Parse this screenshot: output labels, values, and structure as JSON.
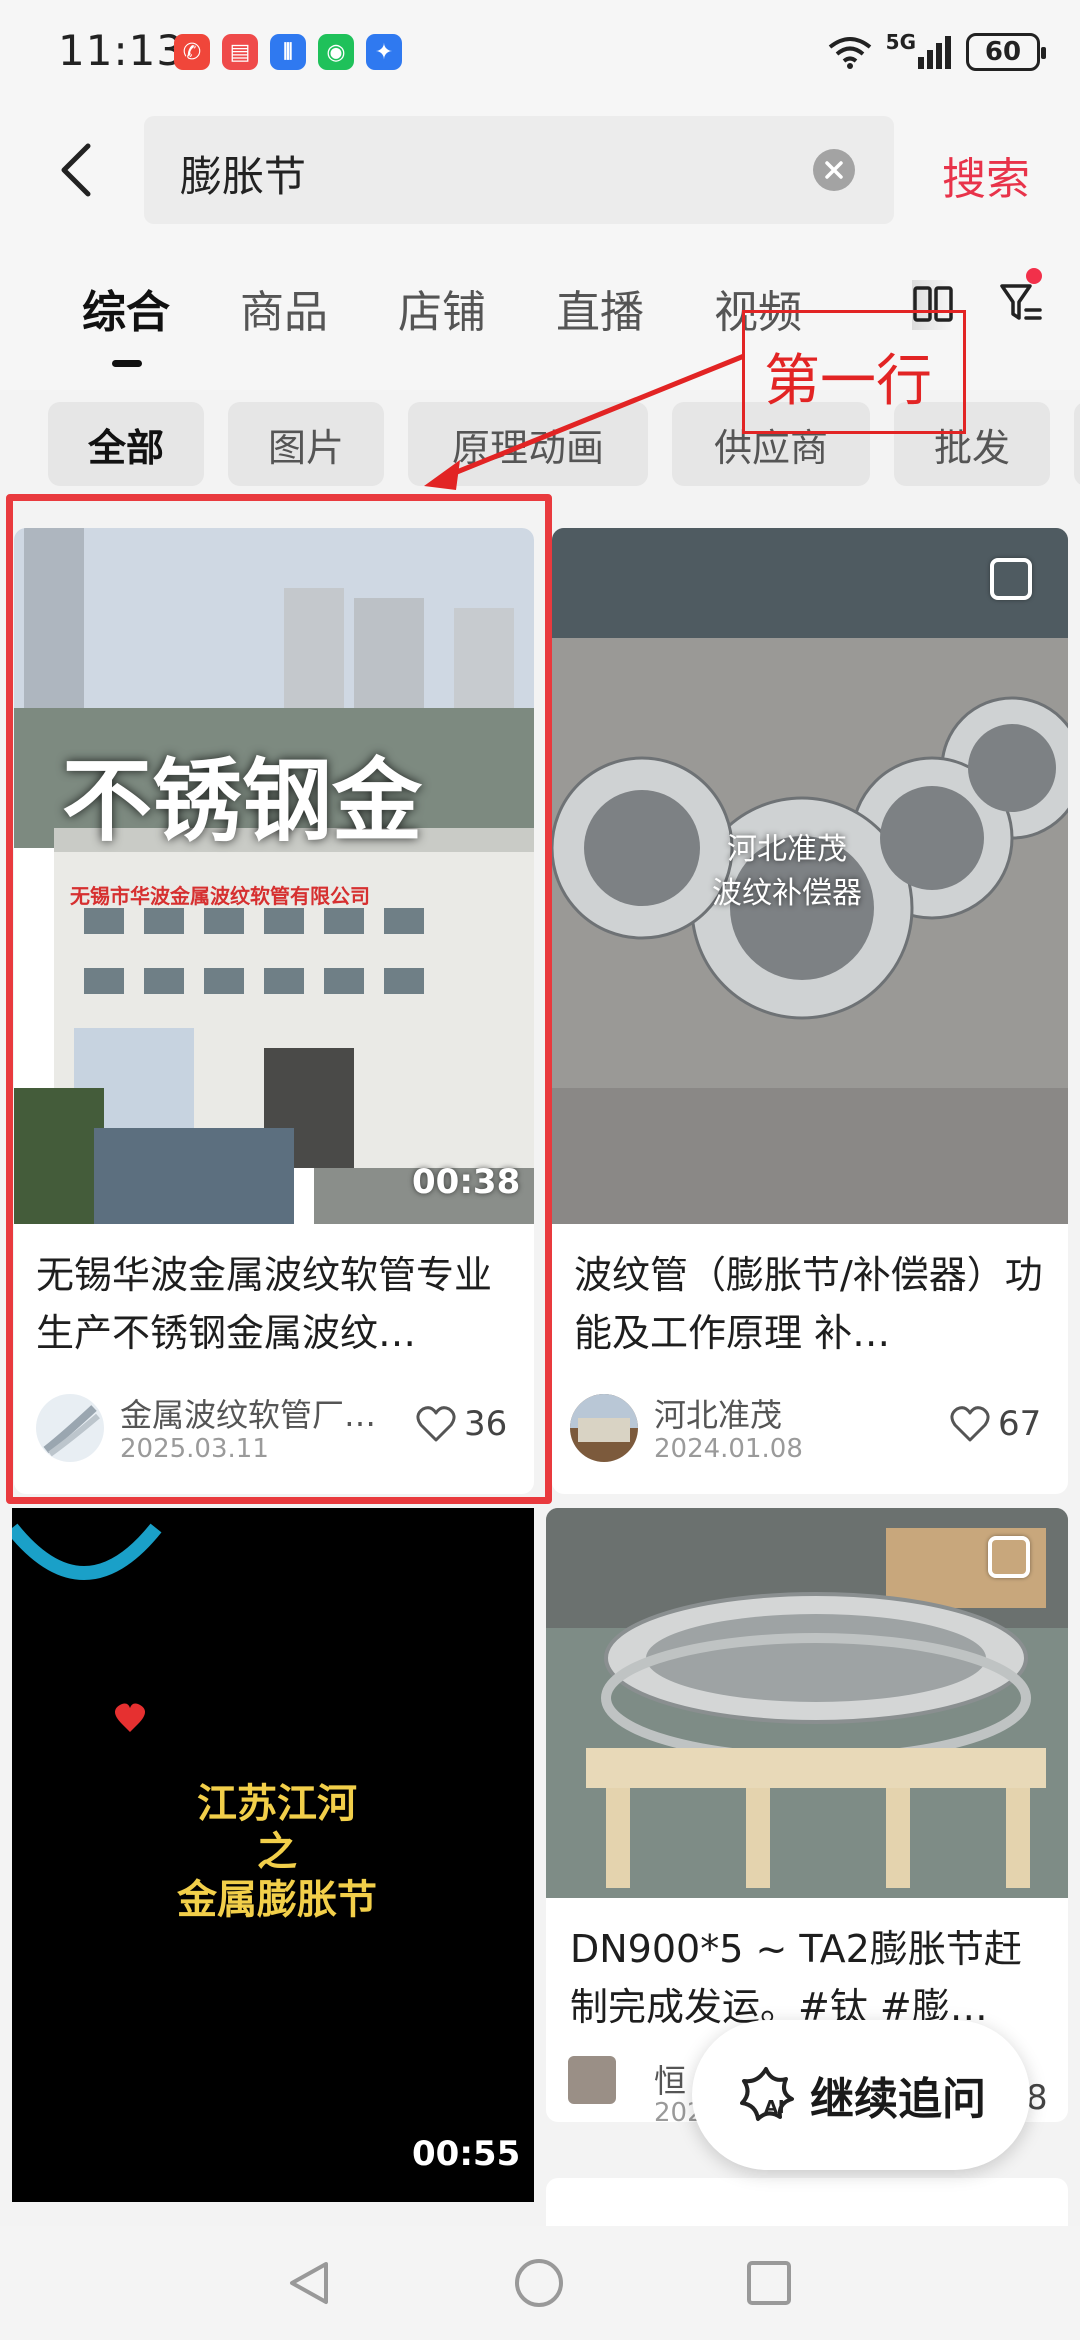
{
  "status_bar": {
    "time": "11:13",
    "network": "5G",
    "battery": "60"
  },
  "search": {
    "query": "膨胀节",
    "search_label": "搜索"
  },
  "tabs": [
    {
      "label": "综合",
      "active": true
    },
    {
      "label": "商品",
      "active": false
    },
    {
      "label": "店铺",
      "active": false
    },
    {
      "label": "直播",
      "active": false
    },
    {
      "label": "视频",
      "active": false
    }
  ],
  "chips": [
    {
      "label": "全部",
      "active": true
    },
    {
      "label": "图片",
      "active": false
    },
    {
      "label": "原理动画",
      "active": false
    },
    {
      "label": "供应商",
      "active": false
    },
    {
      "label": "批发",
      "active": false
    }
  ],
  "annotation": {
    "label": "第一行",
    "color": "#e22424"
  },
  "cards": [
    {
      "image_text": "不锈钢金",
      "sign_text": "无锡市华波金属波纹软管有限公司",
      "duration": "00:38",
      "title": "无锡华波金属波纹软管专业生产不锈钢金属波纹…",
      "author": "金属波纹软管厂…",
      "date": "2025.03.11",
      "likes": "36"
    },
    {
      "image_text": "河北准茂\n波纹补偿器",
      "title": "波纹管（膨胀节/补偿器）功能及工作原理 补…",
      "author": "河北准茂",
      "date": "2024.01.08",
      "likes": "67"
    },
    {
      "image_text": "江苏江河\n之\n金属膨胀节",
      "duration": "00:55"
    },
    {
      "title": "DN900*5 ~ TA2膨胀节赶制完成发运。#钛 #膨…",
      "author": "恒",
      "date": "202",
      "likes": "8"
    }
  ],
  "fab": {
    "label": "继续追问",
    "icon_text": "AI"
  },
  "colors": {
    "accent": "#e8334a",
    "highlight": "#e93a3e"
  }
}
